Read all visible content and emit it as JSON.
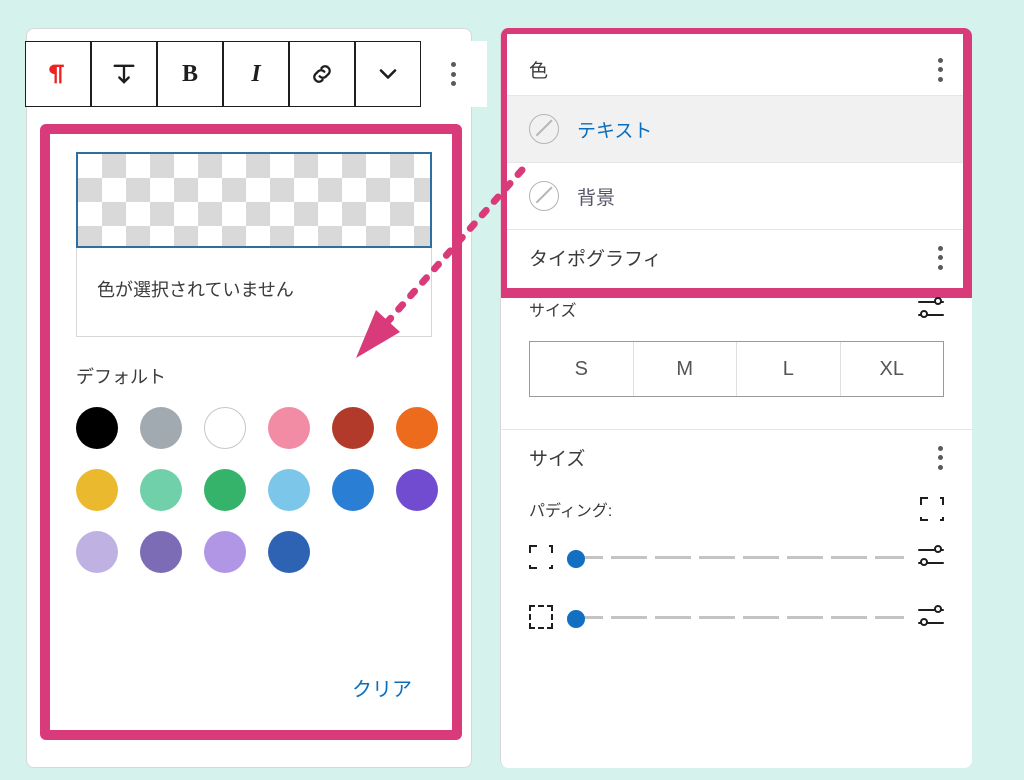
{
  "toolbar": {
    "bold_label": "B",
    "italic_label": "I"
  },
  "color_picker": {
    "no_color_message": "色が選択されていません",
    "default_label": "デフォルト",
    "clear_label": "クリア",
    "palette": [
      "#000000",
      "#a2aab1",
      "#ffffff",
      "#f28ba4",
      "#b23a2a",
      "#ec6b1d",
      "#eab92d",
      "#6fd0a9",
      "#36b36b",
      "#7cc6ea",
      "#2a7fd4",
      "#714cd1",
      "#c0b1e3",
      "#7c6bb5",
      "#b196e6",
      "#2e63b4"
    ]
  },
  "inspector": {
    "color_section_title": "色",
    "text_option": "テキスト",
    "background_option": "背景",
    "typography_title": "タイポグラフィ",
    "size_label": "サイズ",
    "sizes": [
      "S",
      "M",
      "L",
      "XL"
    ],
    "dimensions_title": "サイズ",
    "padding_label": "パディング:"
  }
}
